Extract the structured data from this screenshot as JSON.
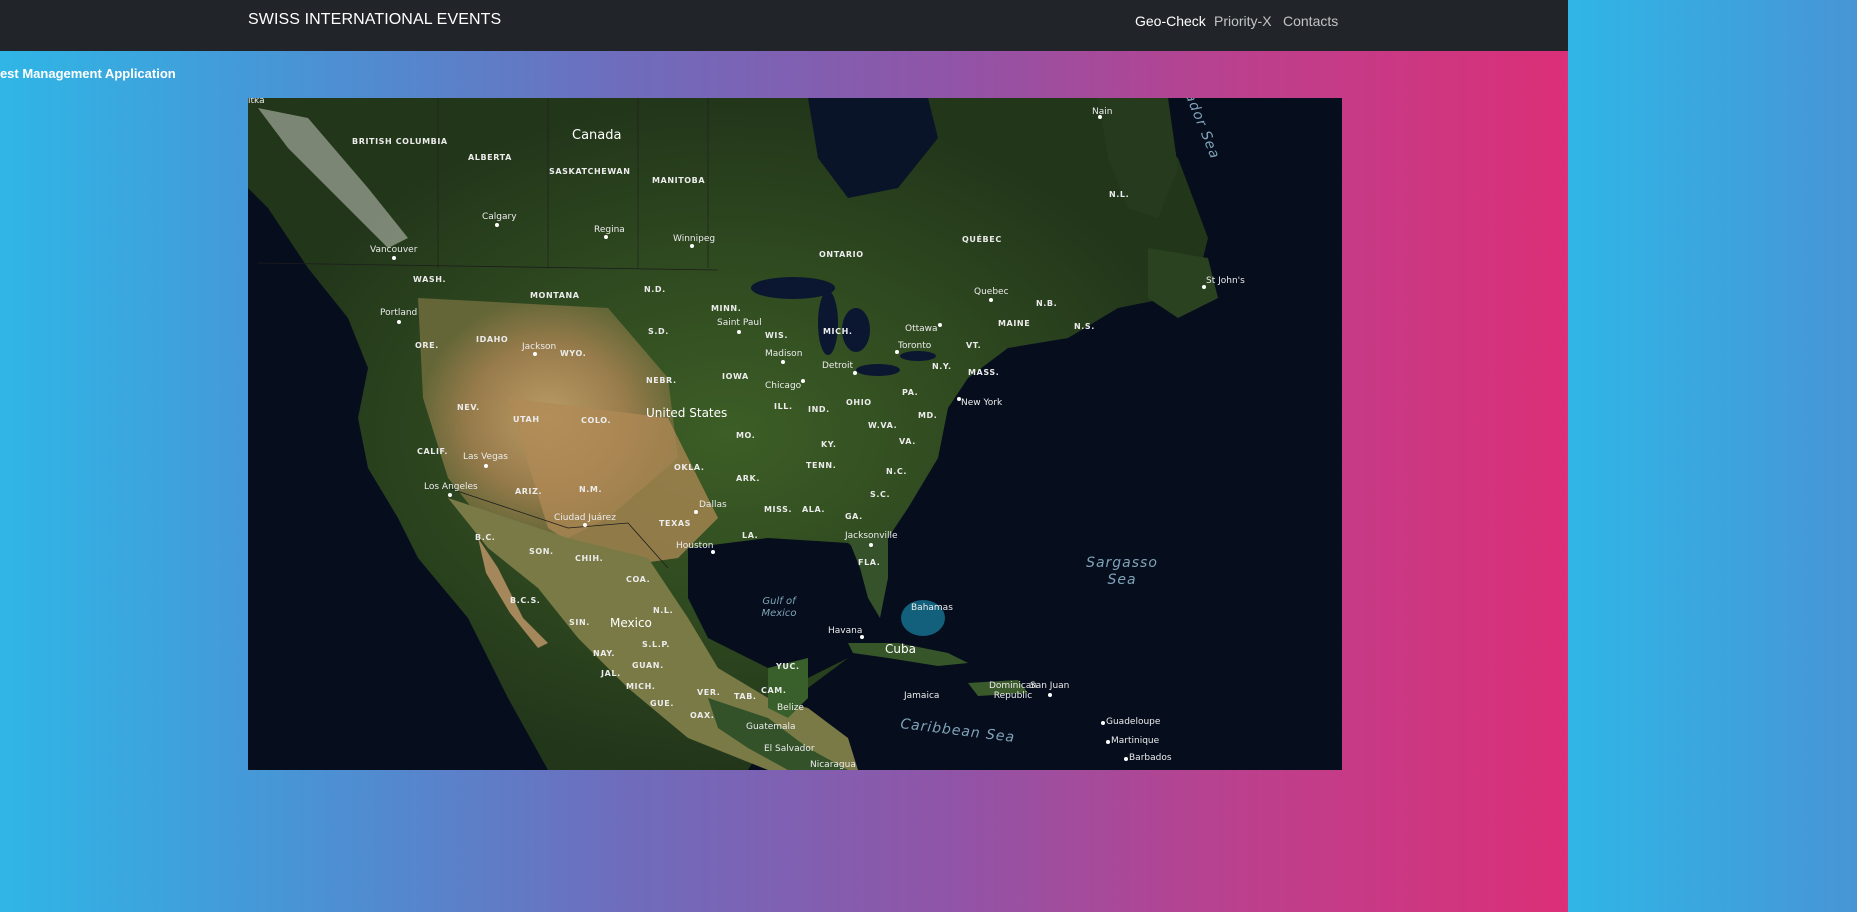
{
  "navbar": {
    "brand": "SWISS INTERNATIONAL EVENTS",
    "links": [
      "Geo-Check",
      "Priority-X",
      "Contacts"
    ]
  },
  "page": {
    "subtitle": "uest Management Application"
  },
  "map": {
    "countries": [
      "Canada",
      "United States",
      "Mexico",
      "Cuba"
    ],
    "provinces": [
      "BRITISH COLUMBIA",
      "ALBERTA",
      "SASKATCHEWAN",
      "MANITOBA",
      "ONTARIO",
      "QUÉBEC",
      "N.L.",
      "N.B.",
      "N.S."
    ],
    "states": [
      "WASH.",
      "ORE.",
      "IDAHO",
      "MONTANA",
      "WYO.",
      "N.D.",
      "S.D.",
      "NEBR.",
      "MINN.",
      "WIS.",
      "MICH.",
      "IOWA",
      "ILL.",
      "IND.",
      "OHIO",
      "PA.",
      "N.Y.",
      "VT.",
      "MAINE",
      "MASS.",
      "NEV.",
      "UTAH",
      "COLO.",
      "CALIF.",
      "ARIZ.",
      "N.M.",
      "OKLA.",
      "MO.",
      "KY.",
      "W.VA.",
      "VA.",
      "MD.",
      "TENN.",
      "N.C.",
      "ARK.",
      "TEXAS",
      "MISS.",
      "ALA.",
      "GA.",
      "S.C.",
      "LA.",
      "FLA.",
      "B.C.",
      "SON.",
      "CHIH.",
      "COA.",
      "B.C.S.",
      "N.L.",
      "SIN.",
      "S.L.P.",
      "NAY.",
      "GUAN.",
      "JAL.",
      "MICH.",
      "GUE.",
      "OAX.",
      "VER.",
      "TAB.",
      "CAM.",
      "YUC."
    ],
    "cities": [
      "Calgary",
      "Regina",
      "Winnipeg",
      "Vancouver",
      "Portland",
      "Jackson",
      "Saint Paul",
      "Madison",
      "Chicago",
      "Detroit",
      "Toronto",
      "Ottawa",
      "Quebec",
      "New York",
      "Las Vegas",
      "Los Angeles",
      "Ciudad Juárez",
      "Dallas",
      "Houston",
      "Jacksonville",
      "Havana",
      "Bahamas",
      "St John's",
      "Nain",
      "Belize",
      "Guatemala",
      "El Salvador",
      "Nicaragua",
      "Jamaica",
      "Dominican Republic",
      "San Juan",
      "Guadeloupe",
      "Martinique",
      "Barbados",
      "itka"
    ],
    "waters": [
      "Gulf of Mexico",
      "Sargasso Sea",
      "Caribbean Sea",
      "ador Sea"
    ],
    "colors": {
      "ocean": "#050b1a",
      "land": "#3a5a2a",
      "desert": "#b89860"
    }
  }
}
